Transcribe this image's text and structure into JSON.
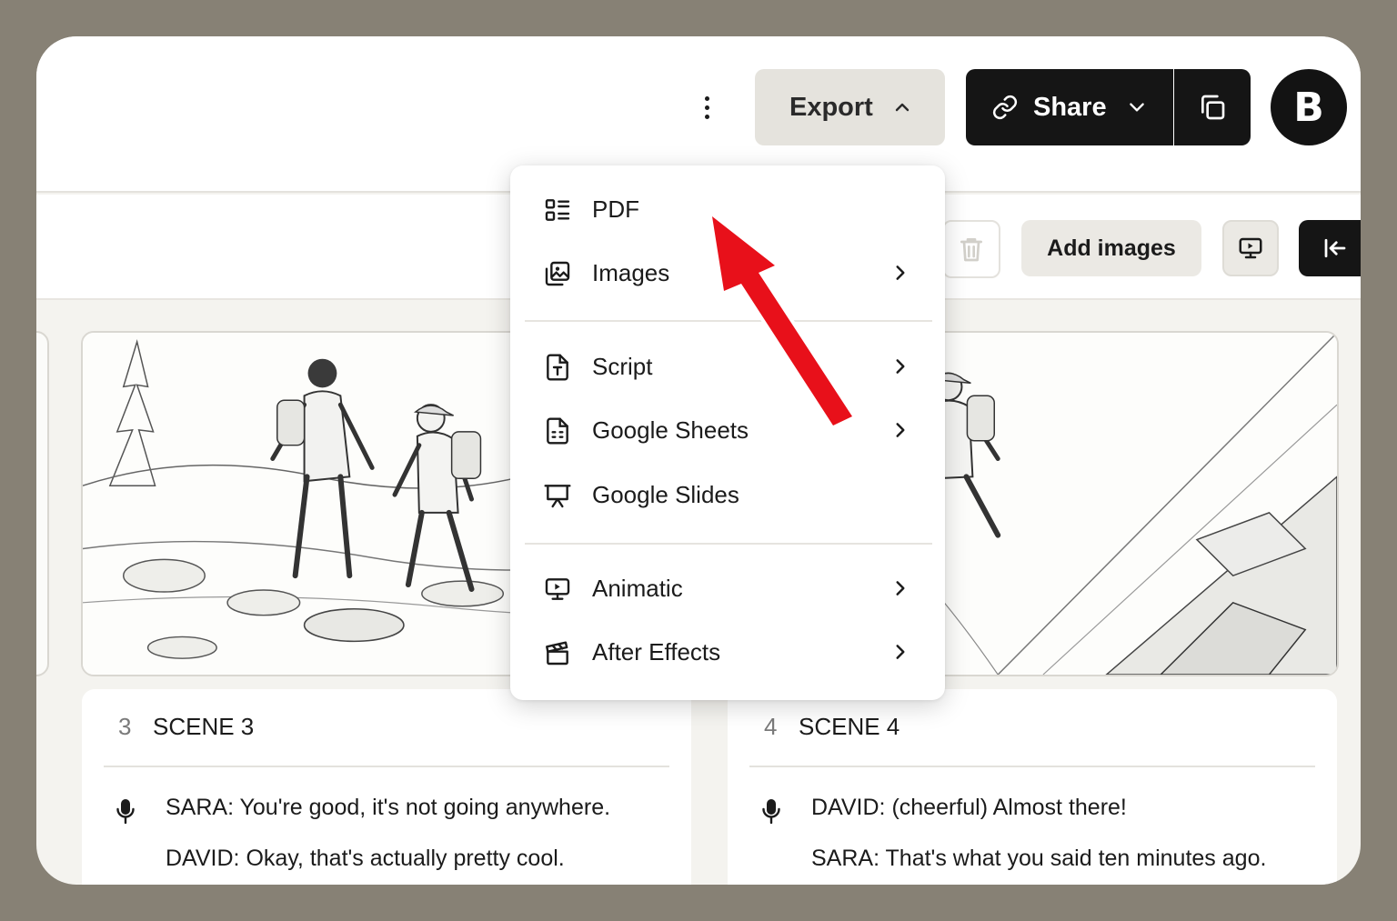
{
  "header": {
    "more_icon": "more-vertical-icon",
    "export_label": "Export",
    "share_label": "Share",
    "avatar_initial": "B"
  },
  "toolbar": {
    "add_images_label": "Add images"
  },
  "export_menu": {
    "items": [
      {
        "label": "PDF",
        "icon": "layout-list-icon",
        "has_submenu": false
      },
      {
        "label": "Images",
        "icon": "images-icon",
        "has_submenu": true
      },
      {
        "label": "Script",
        "icon": "file-text-icon",
        "has_submenu": true
      },
      {
        "label": "Google Sheets",
        "icon": "file-spreadsheet-icon",
        "has_submenu": true
      },
      {
        "label": "Google Slides",
        "icon": "presentation-icon",
        "has_submenu": false
      },
      {
        "label": "Animatic",
        "icon": "monitor-play-icon",
        "has_submenu": true
      },
      {
        "label": "After Effects",
        "icon": "clapperboard-icon",
        "has_submenu": true
      }
    ]
  },
  "scenes": [
    {
      "number": "3",
      "title": "SCENE 3",
      "lines": [
        "SARA: You're good, it's not going anywhere.",
        "DAVID: Okay, that's actually pretty cool."
      ]
    },
    {
      "number": "4",
      "title": "SCENE 4",
      "lines": [
        "DAVID: (cheerful) Almost there!",
        "SARA: That's what you said ten minutes ago."
      ]
    }
  ],
  "colors": {
    "backdrop": "#878175",
    "dark_button": "#151515",
    "export_button": "#e5e3dd",
    "annotation_arrow": "#e8101a"
  }
}
